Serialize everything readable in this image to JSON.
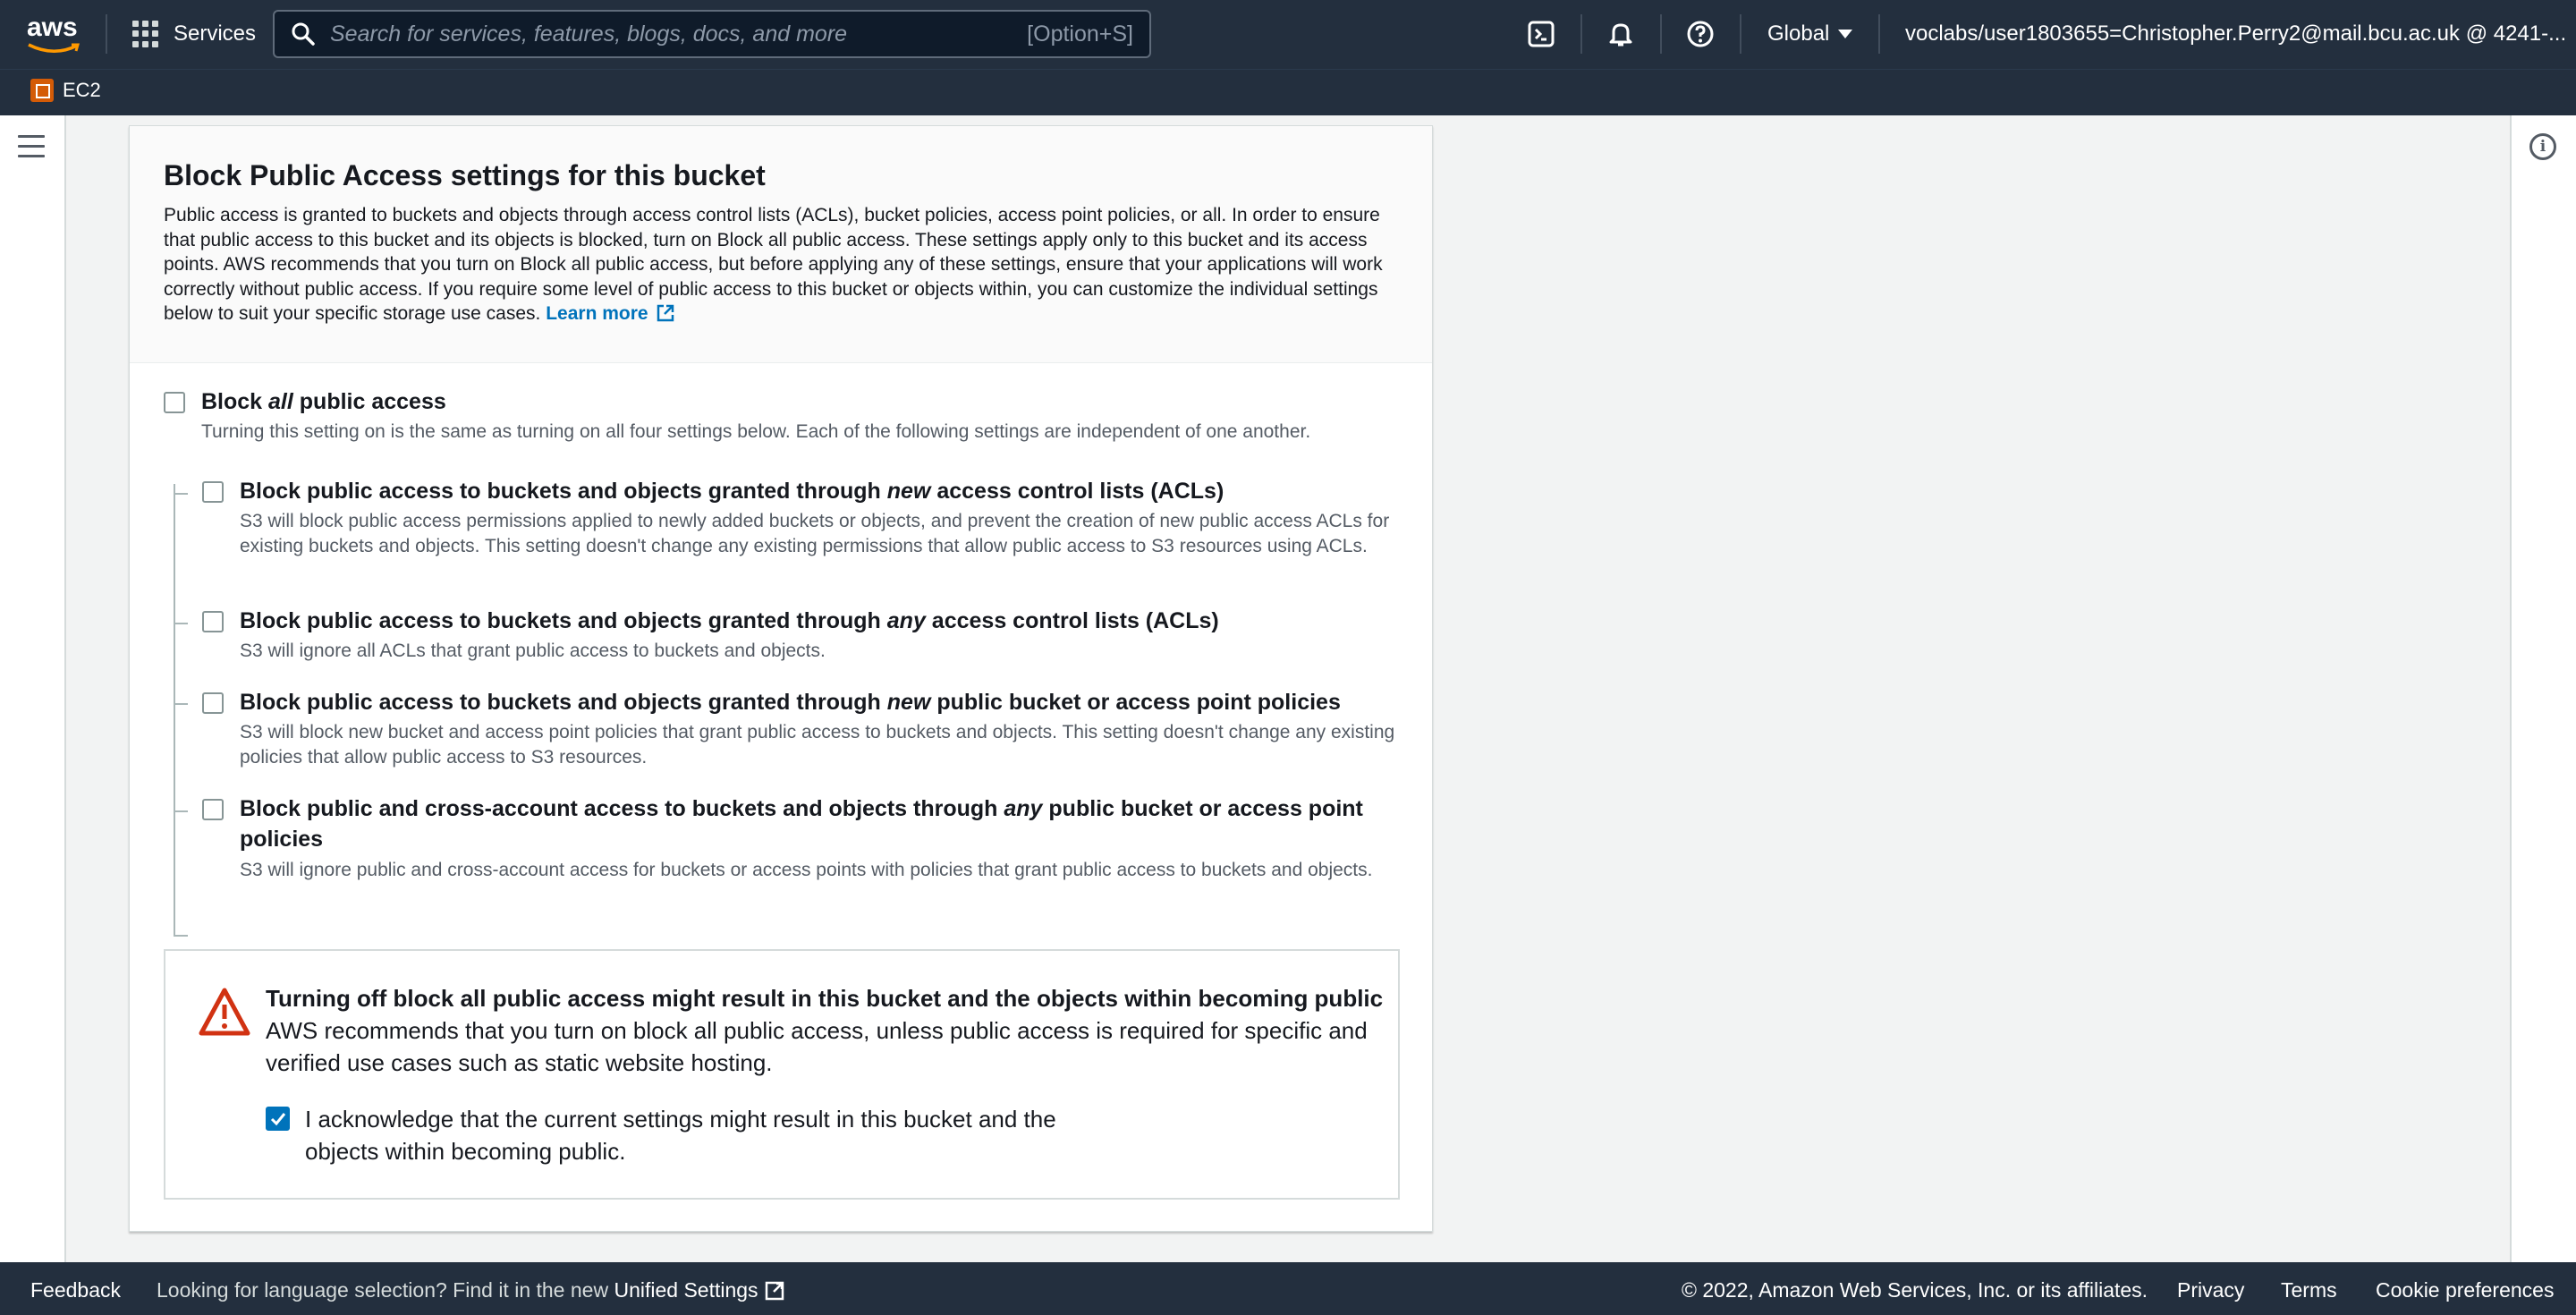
{
  "topnav": {
    "logo": "aws",
    "services_label": "Services",
    "search_placeholder": "Search for services, features, blogs, docs, and more",
    "search_shortcut": "[Option+S]",
    "region_label": "Global",
    "account_label": "voclabs/user1803655=Christopher.Perry2@mail.bcu.ac.uk @ 4241-..."
  },
  "subbar": {
    "service_label": "EC2"
  },
  "panel": {
    "title": "Block Public Access settings for this bucket",
    "description": "Public access is granted to buckets and objects through access control lists (ACLs), bucket policies, access point policies, or all. In order to ensure that public access to this bucket and its objects is blocked, turn on Block all public access. These settings apply only to this bucket and its access points. AWS recommends that you turn on Block all public access, but before applying any of these settings, ensure that your applications will work correctly without public access. If you require some level of public access to this bucket or objects within, you can customize the individual settings below to suit your specific storage use cases.",
    "learn_more": "Learn more",
    "block_all": {
      "title_pre": "Block ",
      "title_em": "all",
      "title_post": " public access",
      "description": "Turning this setting on is the same as turning on all four settings below. Each of the following settings are independent of one another.",
      "checked": false
    },
    "options": [
      {
        "title_pre": "Block public access to buckets and objects granted through ",
        "title_em": "new",
        "title_post": " access control lists (ACLs)",
        "description": "S3 will block public access permissions applied to newly added buckets or objects, and prevent the creation of new public access ACLs for existing buckets and objects. This setting doesn't change any existing permissions that allow public access to S3 resources using ACLs.",
        "checked": false
      },
      {
        "title_pre": "Block public access to buckets and objects granted through ",
        "title_em": "any",
        "title_post": " access control lists (ACLs)",
        "description": "S3 will ignore all ACLs that grant public access to buckets and objects.",
        "checked": false
      },
      {
        "title_pre": "Block public access to buckets and objects granted through ",
        "title_em": "new",
        "title_post": " public bucket or access point policies",
        "description": "S3 will block new bucket and access point policies that grant public access to buckets and objects. This setting doesn't change any existing policies that allow public access to S3 resources.",
        "checked": false
      },
      {
        "title_pre": "Block public and cross-account access to buckets and objects through ",
        "title_em": "any",
        "title_post": " public bucket or access point policies",
        "description": "S3 will ignore public and cross-account access for buckets or access points with policies that grant public access to buckets and objects.",
        "checked": false
      }
    ],
    "alert": {
      "title": "Turning off block all public access might result in this bucket and the objects within becoming public",
      "description": "AWS recommends that you turn on block all public access, unless public access is required for specific and verified use cases such as static website hosting.",
      "ack_label": "I acknowledge that the current settings might result in this bucket and the objects within becoming public.",
      "ack_checked": true
    }
  },
  "footer": {
    "feedback": "Feedback",
    "language_text": "Looking for language selection? Find it in the new",
    "unified_settings": "Unified Settings",
    "copyright": "© 2022, Amazon Web Services, Inc. or its affiliates.",
    "privacy": "Privacy",
    "terms": "Terms",
    "cookie": "Cookie preferences"
  },
  "colors": {
    "nav_bg": "#232f3e",
    "link": "#0073bb",
    "warning": "#d13212",
    "checkbox_checked": "#0073bb"
  }
}
